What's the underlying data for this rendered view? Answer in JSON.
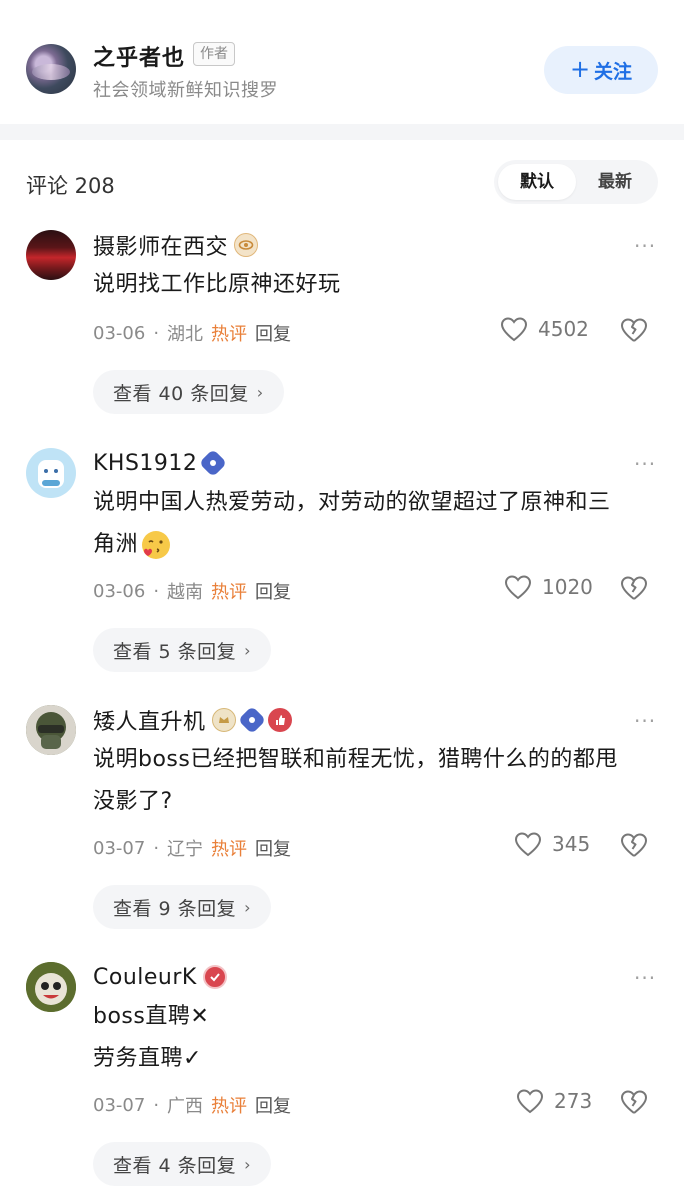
{
  "author": {
    "name": "之乎者也",
    "tag": "作者",
    "desc": "社会领域新鲜知识搜罗",
    "follow_label": "关注"
  },
  "comments_header": {
    "count_label": "评论 208",
    "sort_default": "默认",
    "sort_latest": "最新"
  },
  "colors": {
    "accent": "#1f6fe5",
    "hot": "#e9803a",
    "band": "#f4f5f7"
  },
  "comments": [
    {
      "name": "摄影师在西交",
      "badges": [
        "eye-badge"
      ],
      "text_lines": [
        "说明找工作比原神还好玩"
      ],
      "date": "03-06",
      "location": "湖北",
      "hot": "热评",
      "reply": "回复",
      "likes": "4502",
      "view_replies": "查看 40 条回复"
    },
    {
      "name": "KHS1912",
      "badges": [
        "verified-badge"
      ],
      "text_lines": [
        "说明中国人热爱劳动，对劳动的欲望超过了原神和三",
        "角洲"
      ],
      "emoji": "kiss-emoji",
      "date": "03-06",
      "location": "越南",
      "hot": "热评",
      "reply": "回复",
      "likes": "1020",
      "view_replies": "查看 5 条回复"
    },
    {
      "name": "矮人直升机",
      "badges": [
        "crown-badge",
        "verified-badge",
        "thumb-badge"
      ],
      "text_lines": [
        "说明boss已经把智联和前程无忧，猎聘什么的的都甩",
        "没影了?"
      ],
      "date": "03-07",
      "location": "辽宁",
      "hot": "热评",
      "reply": "回复",
      "likes": "345",
      "view_replies": "查看 9 条回复"
    },
    {
      "name": "CouleurK",
      "badges": [
        "check-badge"
      ],
      "text_lines": [
        "boss直聘✕",
        "劳务直聘✓"
      ],
      "date": "03-07",
      "location": "广西",
      "hot": "热评",
      "reply": "回复",
      "likes": "273",
      "view_replies": "查看 4 条回复"
    }
  ],
  "more_glyph": "···",
  "chevron_glyph": "›",
  "dot_glyph": "·"
}
